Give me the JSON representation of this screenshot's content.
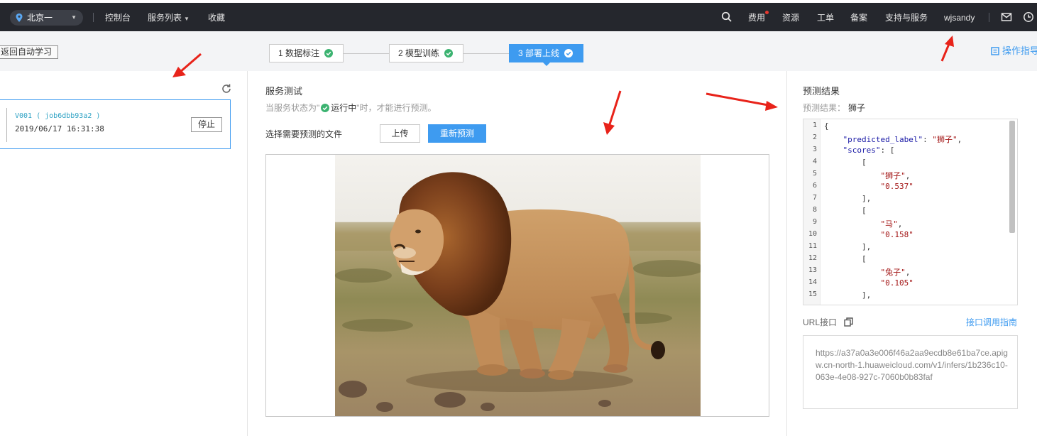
{
  "nav": {
    "region": "北京一",
    "console": "控制台",
    "service_list": "服务列表",
    "favorites": "收藏",
    "billing": "费用",
    "resources": "资源",
    "tickets": "工单",
    "filing": "备案",
    "support": "支持与服务",
    "username": "wjsandy"
  },
  "subbar": {
    "back": "返回自动学习",
    "steps": [
      {
        "label": "1 数据标注"
      },
      {
        "label": "2 模型训练"
      },
      {
        "label": "3 部署上线"
      }
    ],
    "guide": "操作指导"
  },
  "left": {
    "version_name": "V001 ( job6dbb93a2 )",
    "version_time": "2019/06/17 16:31:38",
    "stop": "停止"
  },
  "middle": {
    "title": "服务测试",
    "hint_prefix": "当服务状态为\"",
    "hint_status": "运行中",
    "hint_suffix": "\"时，才能进行预测。",
    "select_file": "选择需要预测的文件",
    "upload": "上传",
    "repredict": "重新预测"
  },
  "right": {
    "title": "预测结果",
    "result_label": "预测结果：",
    "result_value": "狮子",
    "code_lines": [
      "{",
      "    \"predicted_label\": \"狮子\",",
      "    \"scores\": [",
      "        [",
      "            \"狮子\",",
      "            \"0.537\"",
      "        ],",
      "        [",
      "            \"马\",",
      "            \"0.158\"",
      "        ],",
      "        [",
      "            \"兔子\",",
      "            \"0.105\"",
      "        ],"
    ],
    "url_label": "URL接口",
    "url_guide": "接口调用指南",
    "url": "https://a37a0a3e006f46a2aa9ecdb8e61ba7ce.apigw.cn-north-1.huaweicloud.com/v1/infers/1b236c10-063e-4e08-927c-7060b0b83faf"
  },
  "colors": {
    "nav_bg": "#25272d",
    "accent": "#3e9bf0",
    "ok_green": "#3cb371",
    "arrow_red": "#e8231a"
  }
}
